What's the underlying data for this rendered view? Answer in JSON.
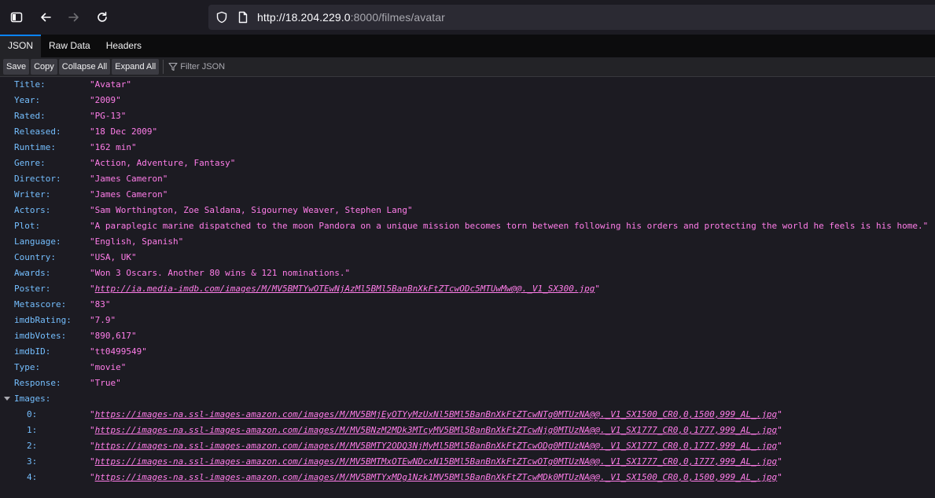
{
  "browser": {
    "url_host": "http://18.204.229.0",
    "url_rest": ":8000/filmes/avatar"
  },
  "tabs": [
    "JSON",
    "Raw Data",
    "Headers"
  ],
  "toolbar": {
    "save": "Save",
    "copy": "Copy",
    "collapse_all": "Collapse All",
    "expand_all": "Expand All",
    "filter_placeholder": "Filter JSON"
  },
  "json": {
    "fields": [
      {
        "key": "Title:",
        "value": "\"Avatar\""
      },
      {
        "key": "Year:",
        "value": "\"2009\""
      },
      {
        "key": "Rated:",
        "value": "\"PG-13\""
      },
      {
        "key": "Released:",
        "value": "\"18 Dec 2009\""
      },
      {
        "key": "Runtime:",
        "value": "\"162 min\""
      },
      {
        "key": "Genre:",
        "value": "\"Action, Adventure, Fantasy\""
      },
      {
        "key": "Director:",
        "value": "\"James Cameron\""
      },
      {
        "key": "Writer:",
        "value": "\"James Cameron\""
      },
      {
        "key": "Actors:",
        "value": "\"Sam Worthington, Zoe Saldana, Sigourney Weaver, Stephen Lang\""
      },
      {
        "key": "Plot:",
        "value": "\"A paraplegic marine dispatched to the moon Pandora on a unique mission becomes torn between following his orders and protecting the world he feels is his home.\""
      },
      {
        "key": "Language:",
        "value": "\"English, Spanish\""
      },
      {
        "key": "Country:",
        "value": "\"USA, UK\""
      },
      {
        "key": "Awards:",
        "value": "\"Won 3 Oscars. Another 80 wins & 121 nominations.\""
      },
      {
        "key": "Poster:",
        "value": "http://ia.media-imdb.com/images/M/MV5BMTYwOTEwNjAzMl5BMl5BanBnXkFtZTcwODc5MTUwMw@@._V1_SX300.jpg",
        "link": true
      },
      {
        "key": "Metascore:",
        "value": "\"83\""
      },
      {
        "key": "imdbRating:",
        "value": "\"7.9\""
      },
      {
        "key": "imdbVotes:",
        "value": "\"890,617\""
      },
      {
        "key": "imdbID:",
        "value": "\"tt0499549\""
      },
      {
        "key": "Type:",
        "value": "\"movie\""
      },
      {
        "key": "Response:",
        "value": "\"True\""
      }
    ],
    "images_key": "Images:",
    "images": [
      {
        "key": "0:",
        "value": "https://images-na.ssl-images-amazon.com/images/M/MV5BMjEyOTYyMzUxNl5BMl5BanBnXkFtZTcwNTg0MTUzNA@@._V1_SX1500_CR0,0,1500,999_AL_.jpg"
      },
      {
        "key": "1:",
        "value": "https://images-na.ssl-images-amazon.com/images/M/MV5BNzM2MDk3MTcyMV5BMl5BanBnXkFtZTcwNjg0MTUzNA@@._V1_SX1777_CR0,0,1777,999_AL_.jpg"
      },
      {
        "key": "2:",
        "value": "https://images-na.ssl-images-amazon.com/images/M/MV5BMTY2ODQ3NjMyMl5BMl5BanBnXkFtZTcwODg0MTUzNA@@._V1_SX1777_CR0,0,1777,999_AL_.jpg"
      },
      {
        "key": "3:",
        "value": "https://images-na.ssl-images-amazon.com/images/M/MV5BMTMxOTEwNDcxN15BMl5BanBnXkFtZTcwOTg0MTUzNA@@._V1_SX1777_CR0,0,1777,999_AL_.jpg"
      },
      {
        "key": "4:",
        "value": "https://images-na.ssl-images-amazon.com/images/M/MV5BMTYxMDg1Nzk1MV5BMl5BanBnXkFtZTcwMDk0MTUzNA@@._V1_SX1500_CR0,0,1500,999_AL_.jpg"
      }
    ]
  }
}
